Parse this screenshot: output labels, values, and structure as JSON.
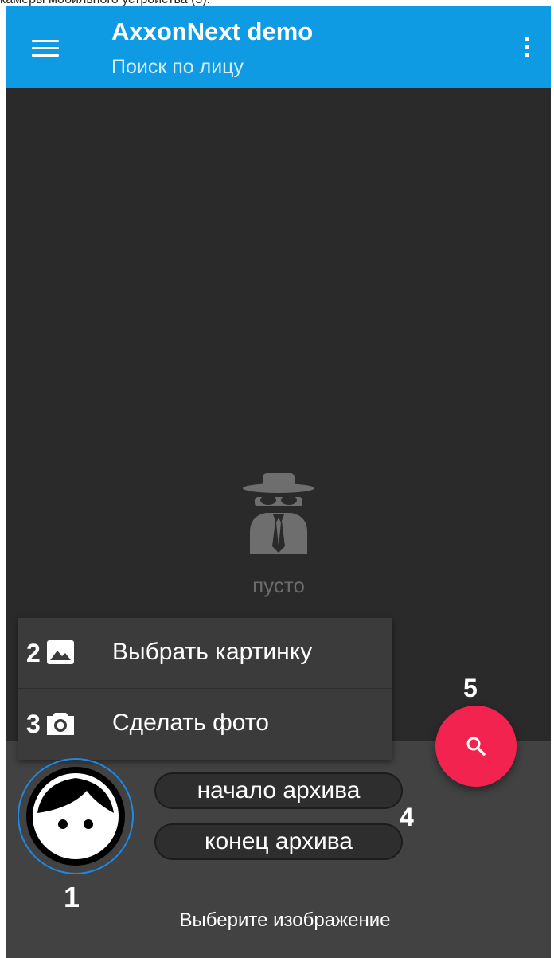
{
  "document": {
    "caption_fragment": "камеры мобильного устройства (5)."
  },
  "appbar": {
    "title": "AxxonNext demo",
    "subtitle": "Поиск по лицу",
    "color": "#0f9be3"
  },
  "results": {
    "empty_text": "пусто",
    "empty_icon": "incognito-icon"
  },
  "popup_menu": {
    "items": [
      {
        "number": "2",
        "icon": "image-icon",
        "label": "Выбрать картинку"
      },
      {
        "number": "3",
        "icon": "camera-icon",
        "label": "Сделать фото"
      }
    ]
  },
  "search_panel": {
    "avatar_number": "1",
    "avatar_icon": "face-icon",
    "start_label": "начало архива",
    "end_label": "конец архива",
    "range_number": "4",
    "hint": "Выберите изображение"
  },
  "fab": {
    "number": "5",
    "icon": "search-icon",
    "color": "#f2234f"
  }
}
